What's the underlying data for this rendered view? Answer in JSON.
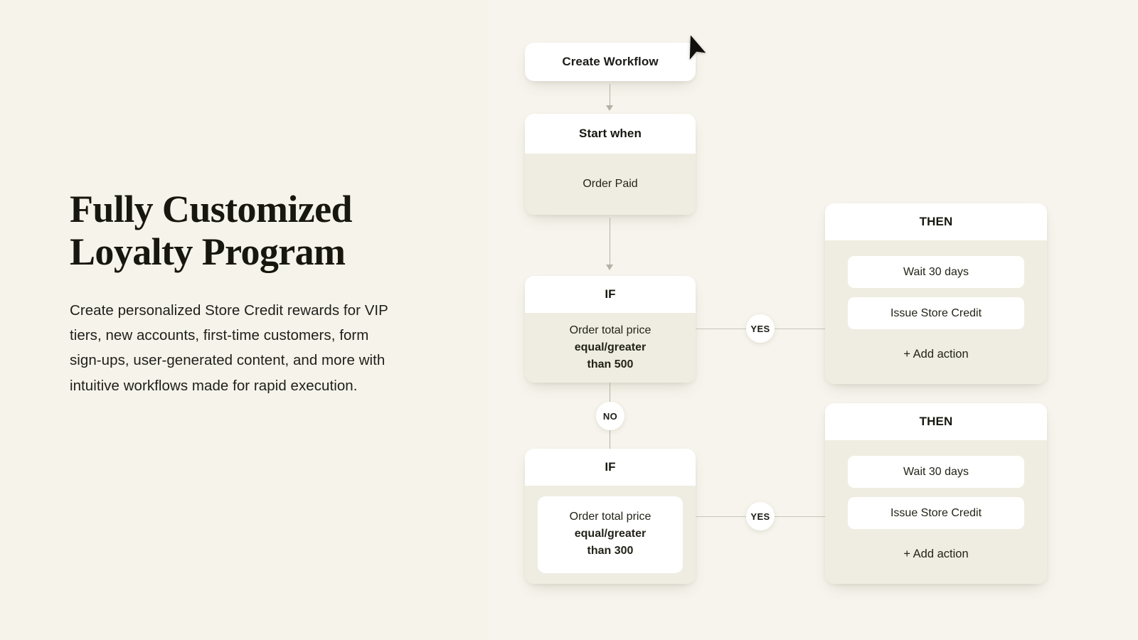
{
  "hero": {
    "title": "Fully Customized\nLoyalty Program",
    "description": "Create personalized Store Credit rewards for VIP tiers, new accounts, first-time customers, form sign-ups, user-generated content, and more with intuitive workflows made for rapid execution."
  },
  "workflow": {
    "create_button": "Create Workflow",
    "trigger": {
      "header": "Start when",
      "value": "Order Paid"
    },
    "conditions": [
      {
        "header": "IF",
        "subject": "Order total price",
        "operator": "equal/greater",
        "threshold": "than 500",
        "yes_label": "YES",
        "no_label": "NO"
      },
      {
        "header": "IF",
        "subject": "Order total price",
        "operator": "equal/greater",
        "threshold": "than 300",
        "yes_label": "YES"
      }
    ],
    "branches": [
      {
        "header": "THEN",
        "actions": [
          "Wait 30 days",
          "Issue Store Credit"
        ],
        "add_action": "+ Add action"
      },
      {
        "header": "THEN",
        "actions": [
          "Wait 30 days",
          "Issue Store Credit"
        ],
        "add_action": "+ Add action"
      }
    ]
  },
  "colors": {
    "page_background": "#F5F3EA",
    "canvas_background": "#F6F4EC",
    "card_header": "#FFFFFF",
    "card_body": "#EFEDE2",
    "text": "#17170F",
    "connector": "#B4B2A6"
  }
}
